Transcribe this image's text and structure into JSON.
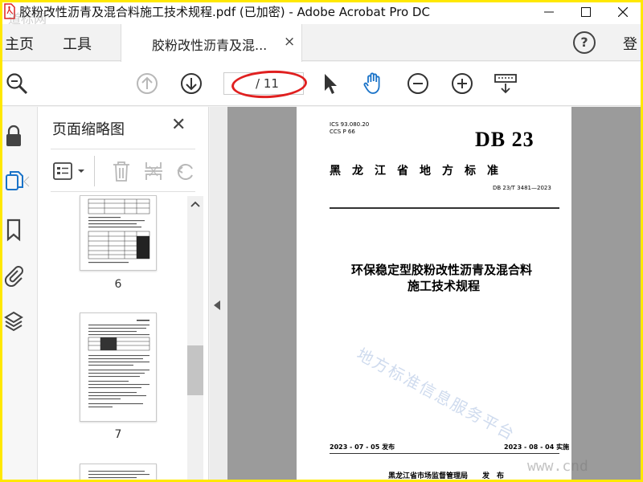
{
  "window": {
    "title": "胶粉改性沥青及混合料施工技术规程.pdf  (已加密)  - Adobe Acrobat Pro DC",
    "corner_watermark": "道标网"
  },
  "tabs": {
    "home": "主页",
    "tools": "工具",
    "document_tab": "胶粉改性沥青及混...",
    "close": "×",
    "login": "登"
  },
  "toolbar": {
    "page_total": "/ 11"
  },
  "thumbnails": {
    "title": "页面缩略图",
    "close": "✕",
    "pages": [
      {
        "label": "6"
      },
      {
        "label": "7"
      }
    ]
  },
  "document": {
    "ics": "ICS  93.080.20",
    "ccs": "CCS  P 66",
    "logo": "DB 23",
    "standard_type": "黑　龙　江　省　地　方　标　准",
    "standard_number": "DB 23/T 3481—2023",
    "title_line1": "环保稳定型胶粉改性沥青及混合料",
    "title_line2": "施工技术规程",
    "watermark": "地方标准信息服务平台",
    "release_date": "2023 - 07 - 05 发布",
    "implement_date": "2023 - 08 - 04 实施",
    "issuer": "黑龙江省市场监督管理局　　发　布"
  },
  "site_watermark": "www.cnd",
  "colors": {
    "highlight_ellipse": "#e02020",
    "hand_tool": "#1a73c8",
    "frame": "#ffe800"
  }
}
